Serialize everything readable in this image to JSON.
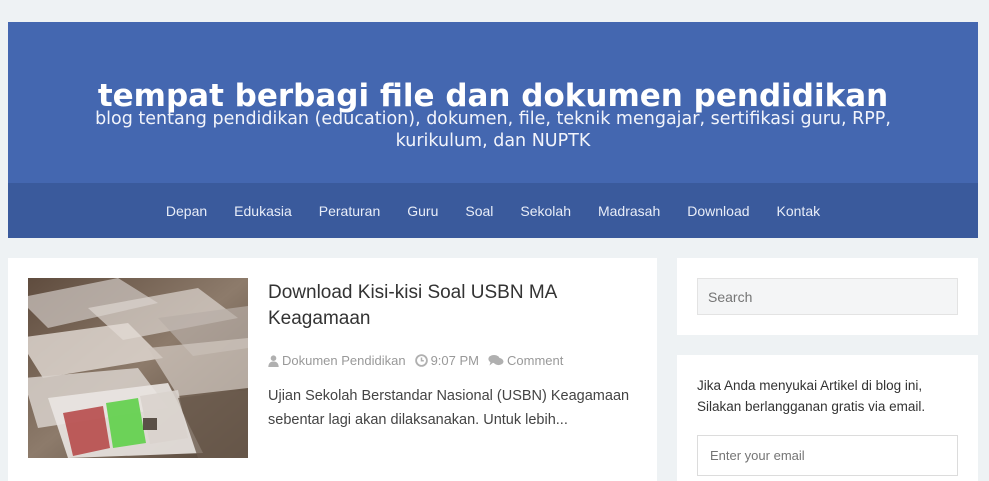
{
  "header": {
    "title": "tempat berbagi file dan dokumen pendidikan",
    "description": "blog tentang pendidikan (education), dokumen, file, teknik mengajar, sertifikasi guru, RPP, kurikulum, dan NUPTK"
  },
  "nav": {
    "items": [
      "Depan",
      "Edukasia",
      "Peraturan",
      "Guru",
      "Soal",
      "Sekolah",
      "Madrasah",
      "Download",
      "Kontak"
    ]
  },
  "post": {
    "title": "Download Kisi-kisi Soal USBN MA Keagamaan",
    "author": "Dokumen Pendidikan",
    "time": "9:07 PM",
    "comment_label": "Comment",
    "excerpt": "Ujian Sekolah Berstandar Nasional (USBN) Keagamaan sebentar lagi akan dilaksanakan. Untuk lebih..."
  },
  "sidebar": {
    "search_placeholder": "Search",
    "subscribe_text": "Jika Anda menyukai Artikel di blog ini, Silakan berlangganan gratis via email.",
    "email_placeholder": "Enter your email"
  },
  "colors": {
    "header_bg": "#4467b0",
    "nav_bg": "#3a5a9c",
    "page_bg": "#eef2f4"
  }
}
